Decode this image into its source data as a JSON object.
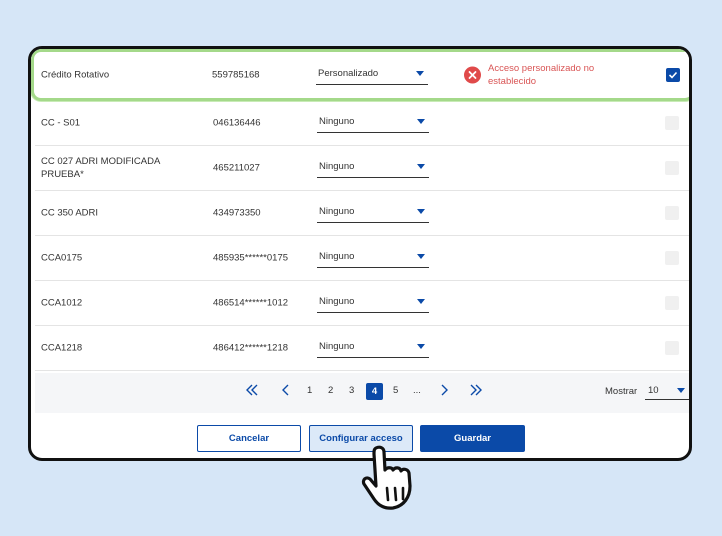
{
  "rows": [
    {
      "name": "Crédito Rotativo",
      "number": "559785168",
      "access": "Personalizado",
      "error": "Acceso personalizado no establecido",
      "checked": true
    },
    {
      "name": "CC - S01",
      "number": "046136446",
      "access": "Ninguno"
    },
    {
      "name": "CC 027 ADRI MODIFICADA PRUEBA*",
      "number": "465211027",
      "access": "Ninguno"
    },
    {
      "name": "CC 350 ADRI",
      "number": "434973350",
      "access": "Ninguno"
    },
    {
      "name": "CCA0175",
      "number": "485935******0175",
      "access": "Ninguno"
    },
    {
      "name": "CCA1012",
      "number": "486514******1012",
      "access": "Ninguno"
    },
    {
      "name": "CCA1218",
      "number": "486412******1218",
      "access": "Ninguno"
    }
  ],
  "pagination": {
    "pages": [
      "1",
      "2",
      "3",
      "4",
      "5",
      "..."
    ],
    "current": "4",
    "show_label": "Mostrar",
    "page_size": "10"
  },
  "buttons": {
    "cancel": "Cancelar",
    "configure": "Configurar acceso",
    "save": "Guardar"
  },
  "colors": {
    "primary": "#0b4aa8",
    "error": "#e04a4a",
    "highlight": "#a4d98a"
  }
}
